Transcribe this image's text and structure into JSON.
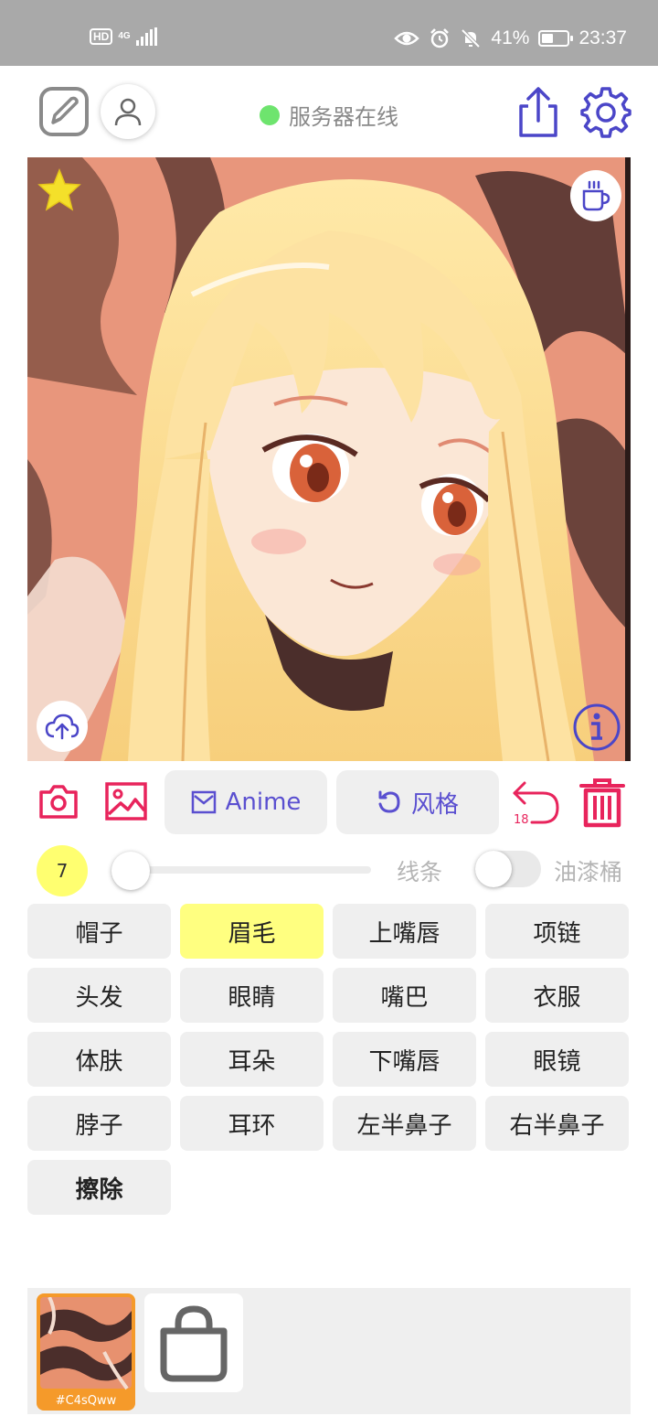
{
  "status_bar": {
    "hd": "HD",
    "network": "4G",
    "battery": "41%",
    "time": "23:37",
    "icons": [
      "eye-icon",
      "alarm-icon",
      "mute-icon",
      "battery-icon"
    ]
  },
  "toolbar": {
    "server_status": "服务器在线",
    "server_color": "#6ee46e",
    "icons": [
      "edit-icon",
      "user-icon",
      "share-icon",
      "gear-icon"
    ]
  },
  "canvas": {
    "icons": [
      "star-icon",
      "coffee-icon",
      "cloud-upload-icon",
      "info-icon"
    ]
  },
  "tools": {
    "anime_label": "Anime",
    "style_label": "风格",
    "undo_count": "18",
    "icons": [
      "camera-icon",
      "image-icon",
      "mail-icon",
      "refresh-icon",
      "undo-icon",
      "trash-icon"
    ]
  },
  "brush": {
    "size": "7",
    "slider_fraction": 0.0,
    "line_label": "线条",
    "bucket_label": "油漆桶",
    "bucket_enabled": false
  },
  "parts": [
    {
      "label": "帽子",
      "selected": false
    },
    {
      "label": "眉毛",
      "selected": true
    },
    {
      "label": "上嘴唇",
      "selected": false
    },
    {
      "label": "项链",
      "selected": false
    },
    {
      "label": "头发",
      "selected": false
    },
    {
      "label": "眼睛",
      "selected": false
    },
    {
      "label": "嘴巴",
      "selected": false
    },
    {
      "label": "衣服",
      "selected": false
    },
    {
      "label": "体肤",
      "selected": false
    },
    {
      "label": "耳朵",
      "selected": false
    },
    {
      "label": "下嘴唇",
      "selected": false
    },
    {
      "label": "眼镜",
      "selected": false
    },
    {
      "label": "脖子",
      "selected": false
    },
    {
      "label": "耳环",
      "selected": false
    },
    {
      "label": "左半鼻子",
      "selected": false
    },
    {
      "label": "右半鼻子",
      "selected": false
    },
    {
      "label": "擦除",
      "selected": false,
      "bold": true
    }
  ],
  "palette": {
    "swatch_label": "#C4sQww",
    "swatch_color": "#f59a2a",
    "icons": [
      "bag-icon"
    ]
  },
  "colors": {
    "accent_purple": "#5a4fd0",
    "accent_pink": "#e8245c",
    "selected_part": "#ffff80"
  }
}
